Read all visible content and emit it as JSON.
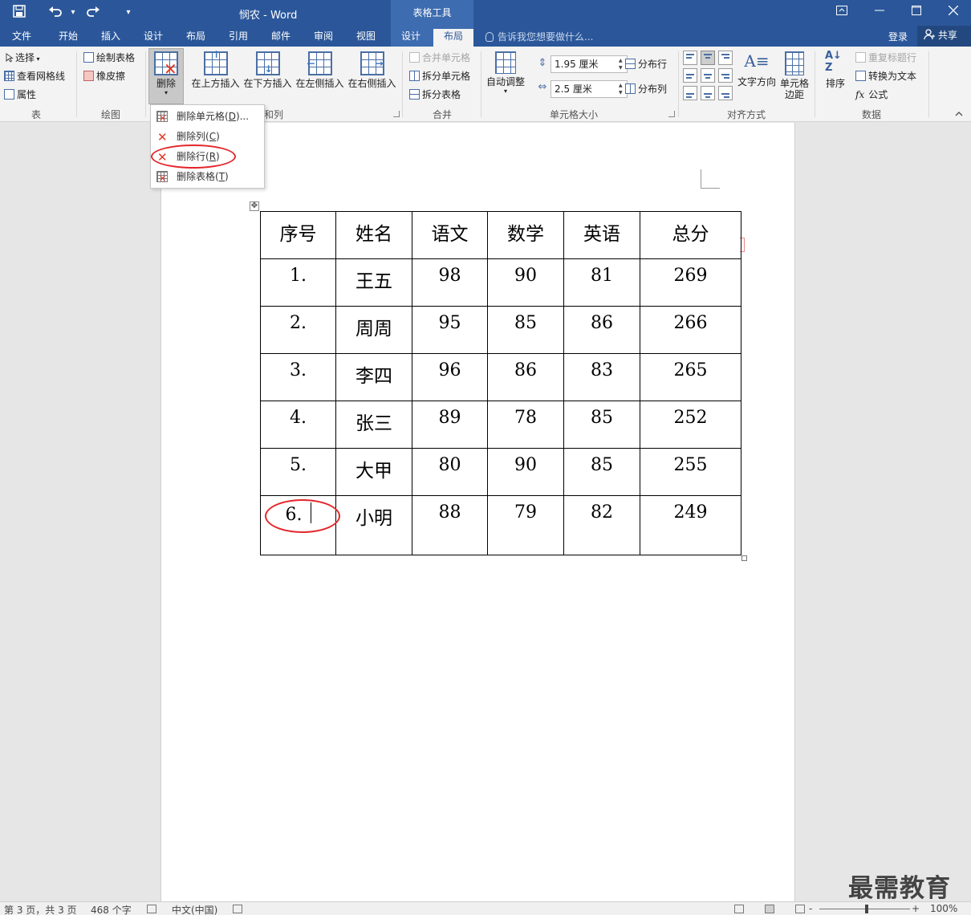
{
  "title_bar": {
    "doc_title": "悯农 - Word",
    "context_group": "表格工具",
    "save_icon": "save-icon",
    "undo_icon": "undo-icon",
    "redo_icon": "redo-icon",
    "customize_icon": "customize-qat-icon"
  },
  "tabs": [
    "文件",
    "开始",
    "插入",
    "设计",
    "布局",
    "引用",
    "邮件",
    "审阅",
    "视图"
  ],
  "context_tabs": [
    "设计",
    "布局"
  ],
  "tell_me": "告诉我您想要做什么...",
  "login": "登录",
  "share": "共享",
  "ribbon": {
    "table_group": {
      "label": "表",
      "select": "选择",
      "gridlines": "查看网格线",
      "properties": "属性"
    },
    "draw_group": {
      "label": "绘图",
      "draw_table": "绘制表格",
      "eraser": "橡皮擦"
    },
    "rows_cols_group": {
      "label": "行和列",
      "label_visible": "和列",
      "delete": "删除",
      "insert_above": "在上方插入",
      "insert_below": "在下方插入",
      "insert_left": "在左侧插入",
      "insert_right": "在右侧插入"
    },
    "merge_group": {
      "label": "合并",
      "merge_cells": "合并单元格",
      "split_cells": "拆分单元格",
      "split_table": "拆分表格"
    },
    "cell_size_group": {
      "label": "单元格大小",
      "autofit": "自动调整",
      "height": "1.95 厘米",
      "width": "2.5 厘米",
      "distribute_rows": "分布行",
      "distribute_cols": "分布列"
    },
    "alignment_group": {
      "label": "对齐方式",
      "text_direction": "文字方向",
      "cell_margins_1": "单元格",
      "cell_margins_2": "边距"
    },
    "data_group": {
      "label": "数据",
      "sort": "排序",
      "repeat_header": "重复标题行",
      "convert_text": "转换为文本",
      "formula": "公式"
    }
  },
  "delete_menu": {
    "items": [
      {
        "text": "删除单元格(",
        "key": "D",
        "suffix": ")..."
      },
      {
        "text": "删除列(",
        "key": "C",
        "suffix": ")"
      },
      {
        "text": "删除行(",
        "key": "R",
        "suffix": ")"
      },
      {
        "text": "删除表格(",
        "key": "T",
        "suffix": ")"
      }
    ]
  },
  "table": {
    "headers": [
      "序号",
      "姓名",
      "语文",
      "数学",
      "英语",
      "总分"
    ],
    "rows": [
      [
        "1.",
        "王五",
        "98",
        "90",
        "81",
        "269"
      ],
      [
        "2.",
        "周周",
        "95",
        "85",
        "86",
        "266"
      ],
      [
        "3.",
        "李四",
        "96",
        "86",
        "83",
        "265"
      ],
      [
        "4.",
        "张三",
        "89",
        "78",
        "85",
        "252"
      ],
      [
        "5.",
        "大甲",
        "80",
        "90",
        "85",
        "255"
      ],
      [
        "6.",
        "小明",
        "88",
        "79",
        "82",
        "249"
      ]
    ]
  },
  "status_bar": {
    "page": "第 3 页，共 3 页",
    "words": "468 个字",
    "language": "中文(中国)",
    "zoom_minus": "-",
    "zoom_plus": "+",
    "zoom": "100%"
  },
  "watermark": "最需教育",
  "colors": {
    "brand": "#2b579a",
    "context": "#3d6cb0",
    "highlight": "#e4262b"
  }
}
